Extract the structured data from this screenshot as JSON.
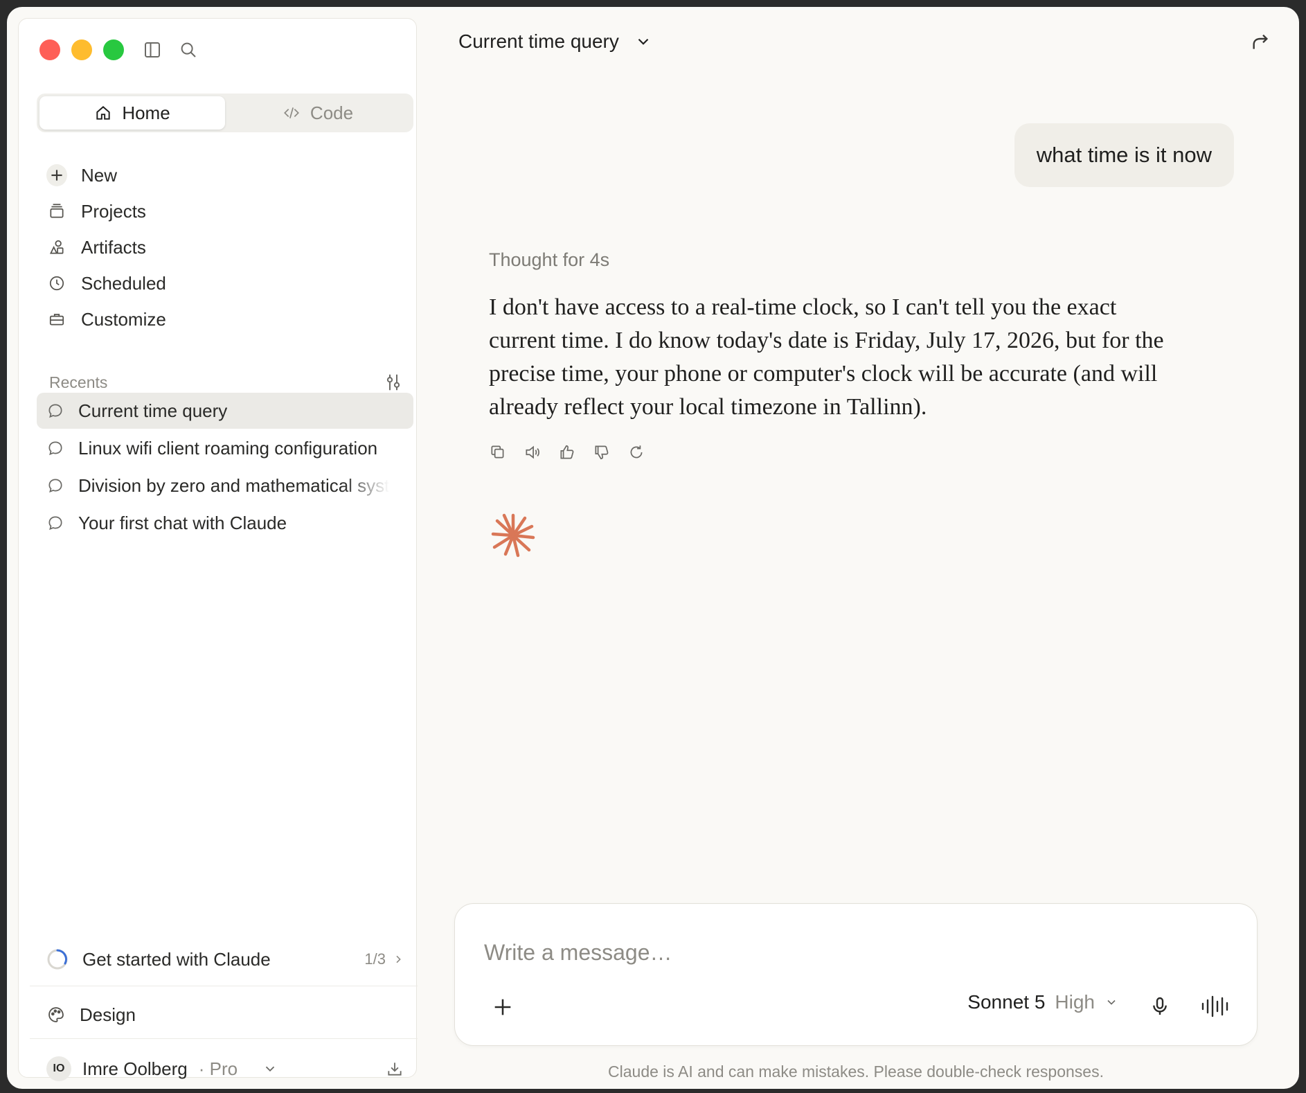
{
  "sidebar": {
    "tabs": [
      {
        "label": "Home",
        "active": true
      },
      {
        "label": "Code",
        "active": false
      }
    ],
    "nav": [
      {
        "label": "New",
        "icon": "plus-icon"
      },
      {
        "label": "Projects",
        "icon": "projects-icon"
      },
      {
        "label": "Artifacts",
        "icon": "artifacts-icon"
      },
      {
        "label": "Scheduled",
        "icon": "clock-icon"
      },
      {
        "label": "Customize",
        "icon": "briefcase-icon"
      }
    ],
    "recents_title": "Recents",
    "recents": [
      {
        "label": "Current time query",
        "active": true
      },
      {
        "label": "Linux wifi client roaming configuration",
        "active": false
      },
      {
        "label": "Division by zero and mathematical syst",
        "active": false
      },
      {
        "label": "Your first chat with Claude",
        "active": false
      }
    ],
    "get_started": {
      "label": "Get started with Claude",
      "progress": "1/3"
    },
    "design_label": "Design",
    "user": {
      "initials": "IO",
      "name": "Imre Oolberg",
      "plan": "· Pro"
    }
  },
  "chat": {
    "title": "Current time query",
    "user_message": "what time is it now",
    "thought_label": "Thought for 4s",
    "reply": "I don't have access to a real-time clock, so I can't tell you the exact current time. I do know today's date is Friday, July 17, 2026, but for the precise time, your phone or computer's clock will be accurate (and will already reflect your local timezone in Tallinn)."
  },
  "composer": {
    "placeholder": "Write a message…",
    "model_name": "Sonnet 5",
    "model_level": "High"
  },
  "disclaimer": "Claude is AI and can make mistakes. Please double-check responses.",
  "colors": {
    "accent": "#d97757",
    "window_bg": "#faf9f6"
  }
}
